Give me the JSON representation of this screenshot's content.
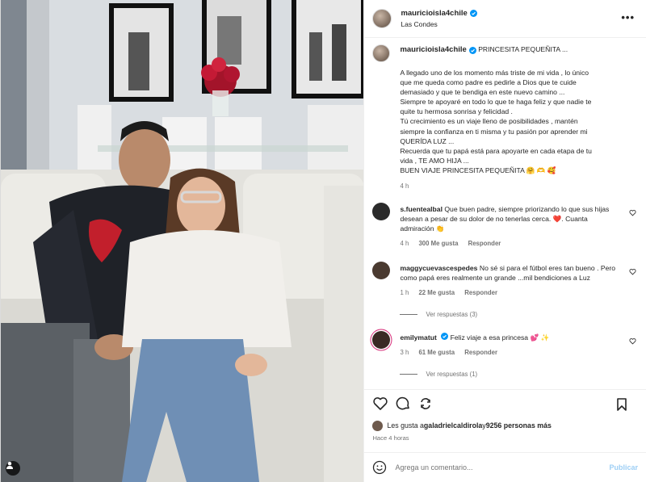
{
  "header": {
    "username": "mauricioisla4chile",
    "location": "Las Condes",
    "more_icon": "more-horizontal-icon"
  },
  "caption": {
    "username": "mauricioisla4chile",
    "title": "PRINCESITA PEQUEÑITA ...",
    "text": "A llegado uno de los momento más triste de mi vida , lo único\nque me queda como padre es pedirle a Dios que te cuide\ndemasiado y que te bendiga en este nuevo camino ...\nSiempre te apoyaré en todo lo que te haga feliz y que nadie te\nquite tu hermosa sonrisa y felicidad .\nTú crecimiento es un viaje lleno de posibilidades , mantén\nsiempre la confianza en ti misma y tu pasión por aprender mi\nQUERÍDA LUZ ...\nRecuerda que tu papá está para apoyarte en cada etapa de tu\nvida , TE AMO HIJA ...\nBUEN VIAJE PRINCESITA PEQUEÑITA 🤗 🫶 🥰",
    "time": "4 h"
  },
  "comments": [
    {
      "username": "s.fuentealbal",
      "text": "Que buen padre, siempre priorizando lo que sus hijas desean a pesar de su dolor de no tenerlas cerca. ❤️. Cuanta admiración 👏",
      "time": "4 h",
      "likes": "300 Me gusta",
      "reply": "Responder",
      "avatar_color": "#2b2b2b"
    },
    {
      "username": "maggycuevascespedes",
      "text": "No sé si para el fútbol eres tan bueno . Pero como papá eres realmente un grande ...mil bendiciones a Luz",
      "time": "1 h",
      "likes": "22 Me gusta",
      "reply": "Responder",
      "replies": "Ver respuestas (3)",
      "avatar_color": "#4a3a30"
    },
    {
      "username": "emilymatut",
      "text": "Feliz viaje a esa princesa 💕 ✨",
      "time": "3 h",
      "likes": "61 Me gusta",
      "reply": "Responder",
      "replies": "Ver respuestas (1)",
      "avatar_color": "#3a2a25"
    }
  ],
  "actions": {
    "like_icon": "heart-icon",
    "comment_icon": "comment-icon",
    "share_icon": "share-icon",
    "save_icon": "bookmark-icon"
  },
  "likes": {
    "prefix": "Les gusta a ",
    "user": "galadrielcaldirola",
    "middle": " y ",
    "count": "9256 personas más"
  },
  "posted": "Hace 4 horas",
  "add_comment": {
    "placeholder": "Agrega un comentario...",
    "post_label": "Publicar",
    "emoji_icon": "emoji-icon"
  },
  "colors": {
    "verified": "#0095f6",
    "muted": "#737373",
    "post_disabled": "#9ecff5",
    "heart_red": "#ed4956"
  }
}
